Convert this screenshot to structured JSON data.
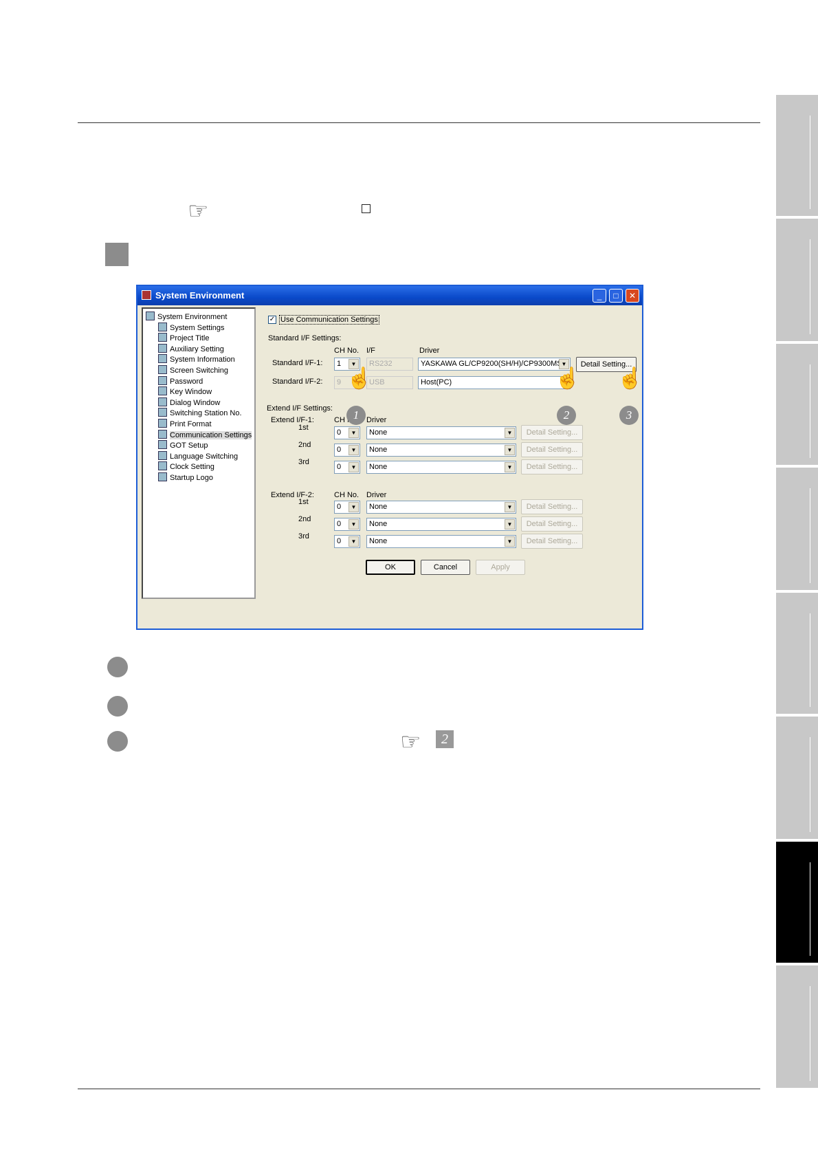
{
  "dialog": {
    "title": "System Environment",
    "tree": [
      {
        "label": "System Environment",
        "level": "root",
        "icon": "system-environment-icon"
      },
      {
        "label": "System Settings",
        "level": "child",
        "icon": "system-settings-icon"
      },
      {
        "label": "Project Title",
        "level": "child",
        "icon": "project-title-icon"
      },
      {
        "label": "Auxiliary Setting",
        "level": "child",
        "icon": "auxiliary-setting-icon"
      },
      {
        "label": "System Information",
        "level": "child",
        "icon": "system-information-icon"
      },
      {
        "label": "Screen Switching",
        "level": "child",
        "icon": "screen-switching-icon"
      },
      {
        "label": "Password",
        "level": "child",
        "icon": "password-icon"
      },
      {
        "label": "Key Window",
        "level": "child",
        "icon": "key-window-icon"
      },
      {
        "label": "Dialog Window",
        "level": "child",
        "icon": "dialog-window-icon"
      },
      {
        "label": "Switching Station No.",
        "level": "child",
        "icon": "switching-station-icon"
      },
      {
        "label": "Print Format",
        "level": "child",
        "icon": "print-format-icon"
      },
      {
        "label": "Communication Settings",
        "level": "child",
        "icon": "communication-settings-icon",
        "selected": true
      },
      {
        "label": "GOT Setup",
        "level": "child",
        "icon": "got-setup-icon"
      },
      {
        "label": "Language Switching",
        "level": "child",
        "icon": "language-switching-icon"
      },
      {
        "label": "Clock Setting",
        "level": "child",
        "icon": "clock-setting-icon"
      },
      {
        "label": "Startup Logo",
        "level": "child",
        "icon": "startup-logo-icon"
      }
    ],
    "use_comm_label": "Use Communication Settings",
    "use_comm_checked": true,
    "standard_label": "Standard I/F Settings:",
    "col_ch": "CH No.",
    "col_if": "I/F",
    "col_driver": "Driver",
    "std1_label": "Standard I/F-1:",
    "std1_ch": "1",
    "std1_if": "RS232",
    "std1_driver": "YASKAWA GL/CP9200(SH/H)/CP9300MS",
    "std2_label": "Standard I/F-2:",
    "std2_ch": "9",
    "std2_if": "USB",
    "std2_driver": "Host(PC)",
    "detail_setting": "Detail Setting...",
    "extend_label": "Extend I/F Settings:",
    "ext1_label": "Extend I/F-1:",
    "ext1_col_ch": "CH N",
    "ext1_col_driver": "Driver",
    "ext2_label": "Extend I/F-2:",
    "ext2_col_ch": "CH No.",
    "ext2_col_driver": "Driver",
    "ext_rows": [
      {
        "name": "1st",
        "ch": "0",
        "driver": "None",
        "detail": "Detail Setting..."
      },
      {
        "name": "2nd",
        "ch": "0",
        "driver": "None",
        "detail": "Detail Setting..."
      },
      {
        "name": "3rd",
        "ch": "0",
        "driver": "None",
        "detail": "Detail Setting..."
      }
    ],
    "ext2_rows": [
      {
        "name": "1st",
        "ch": "0",
        "driver": "None",
        "detail": "Detail Setting..."
      },
      {
        "name": "2nd",
        "ch": "0",
        "driver": "None",
        "detail": "Detail Setting..."
      },
      {
        "name": "3rd",
        "ch": "0",
        "driver": "None",
        "detail": "Detail Setting..."
      }
    ],
    "ok": "OK",
    "cancel": "Cancel",
    "apply": "Apply"
  },
  "callouts": [
    "1",
    "2",
    "3"
  ],
  "reference_number": "2"
}
